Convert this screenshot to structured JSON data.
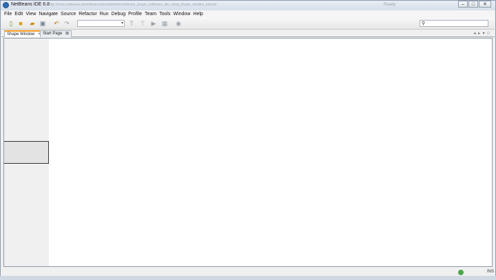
{
  "window": {
    "title": "NetBeans IDE 6.8",
    "url_watermark": "http://tools.netbeans.dz/netbeans/tutorials/html/netbeans_plugin_netbeans_ide_using_shape_window_tutorial",
    "tray_text": "Ready",
    "buttons": {
      "minimize": "–",
      "maximize": "□",
      "close": "✕"
    }
  },
  "menu": {
    "items": [
      "File",
      "Edit",
      "View",
      "Navigate",
      "Source",
      "Refactor",
      "Run",
      "Debug",
      "Profile",
      "Team",
      "Tools",
      "Window",
      "Help"
    ]
  },
  "toolbar": {
    "icons": [
      "new-file-icon",
      "new-project-icon",
      "open-project-icon",
      "save-all-icon",
      "undo-icon",
      "redo-icon",
      "build-icon",
      "clean-build-icon",
      "run-icon",
      "debug-icon",
      "profile-icon"
    ],
    "config_value": "",
    "search_placeholder": ""
  },
  "tabs": [
    {
      "label": "Shape Window",
      "active": true,
      "close": "×"
    },
    {
      "label": "Start Page",
      "active": false,
      "close": "⊠"
    }
  ],
  "tab_controls": "◂ ▸ ▾ □",
  "status": {
    "right_text": "INS"
  }
}
